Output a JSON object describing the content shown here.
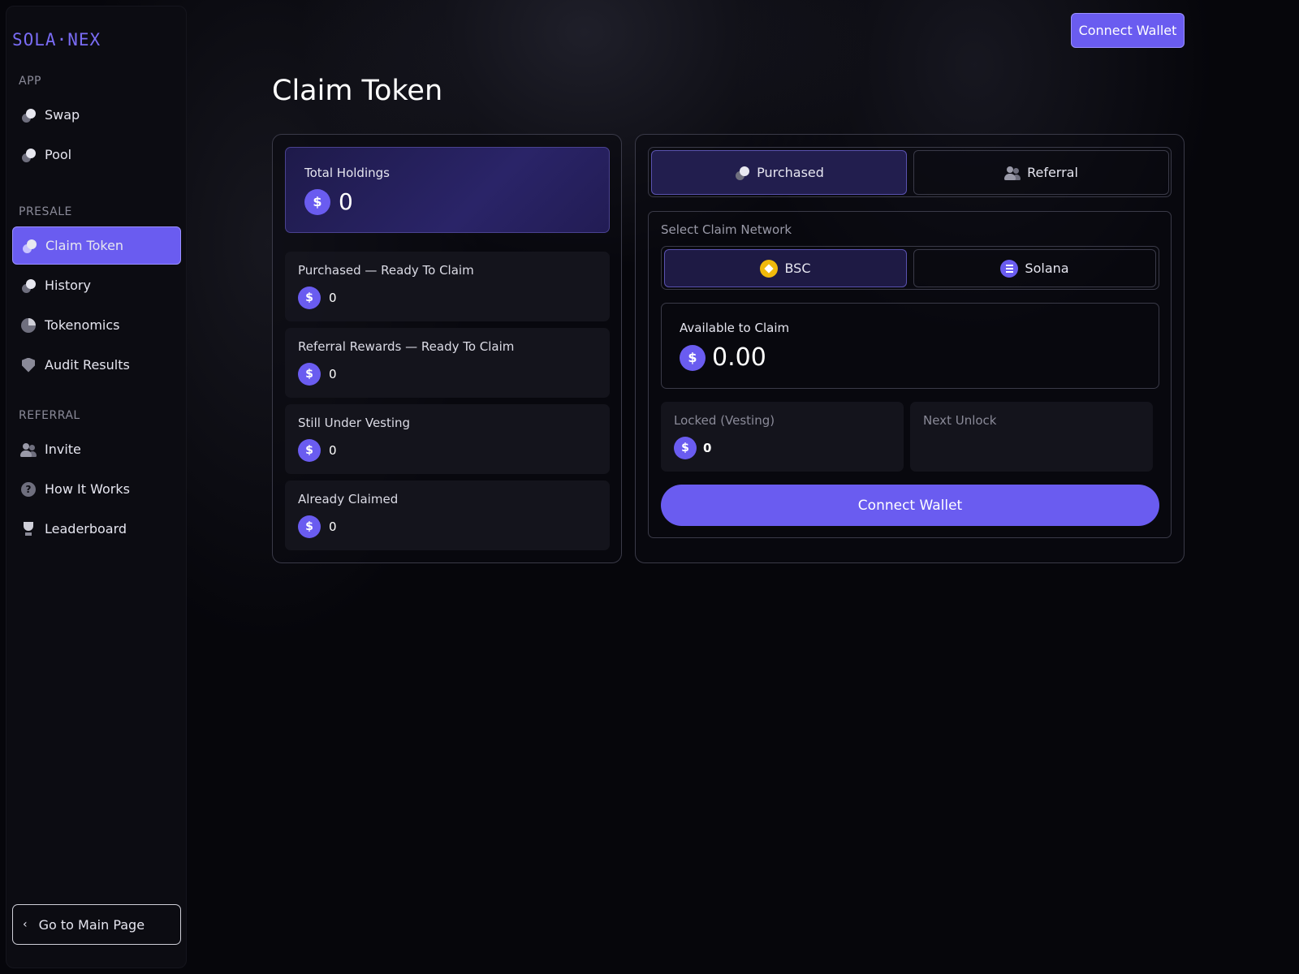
{
  "brand": {
    "logo_text": "SOLA·NEX",
    "accent": "#6a5cf0"
  },
  "sidebar": {
    "sections": {
      "app": "APP",
      "presale": "PRESALE",
      "referral": "REFERRAL"
    },
    "items": [
      {
        "label": "Swap",
        "icon": "coins-icon"
      },
      {
        "label": "Pool",
        "icon": "coins-icon"
      },
      {
        "label": "Claim Token",
        "icon": "coins-icon",
        "active": true
      },
      {
        "label": "History",
        "icon": "coins-icon"
      },
      {
        "label": "Tokenomics",
        "icon": "pie-chart-icon"
      },
      {
        "label": "Audit Results",
        "icon": "shield-icon"
      },
      {
        "label": "Invite",
        "icon": "users-icon"
      },
      {
        "label": "How It Works",
        "icon": "help-icon"
      },
      {
        "label": "Leaderboard",
        "icon": "trophy-icon"
      }
    ],
    "back_label": "Go to Main Page",
    "back_icon": "chevron-left-icon"
  },
  "header": {
    "connect_label": "Connect Wallet"
  },
  "page": {
    "title": "Claim Token"
  },
  "token_icon_glyph": "$",
  "left": {
    "total": {
      "label": "Total Holdings",
      "value": "0"
    },
    "stats": [
      {
        "label": "Purchased — Ready To Claim",
        "value": "0"
      },
      {
        "label": "Referral Rewards — Ready To Claim",
        "value": "0"
      },
      {
        "label": "Still Under Vesting",
        "value": "0"
      },
      {
        "label": "Already Claimed",
        "value": "0"
      }
    ]
  },
  "right": {
    "tabs": [
      {
        "label": "Purchased",
        "icon": "coins-icon",
        "active": true
      },
      {
        "label": "Referral",
        "icon": "users-icon",
        "active": false
      }
    ],
    "network": {
      "label": "Select Claim Network",
      "options": [
        {
          "label": "BSC",
          "icon": "bnb-icon",
          "active": true
        },
        {
          "label": "Solana",
          "icon": "solana-icon",
          "active": false
        }
      ]
    },
    "available": {
      "label": "Available to Claim",
      "value": "0.00"
    },
    "locked": {
      "label": "Locked (Vesting)",
      "value": "0"
    },
    "next_unlock": {
      "label": "Next Unlock",
      "value": ""
    },
    "connect_label": "Connect Wallet"
  }
}
